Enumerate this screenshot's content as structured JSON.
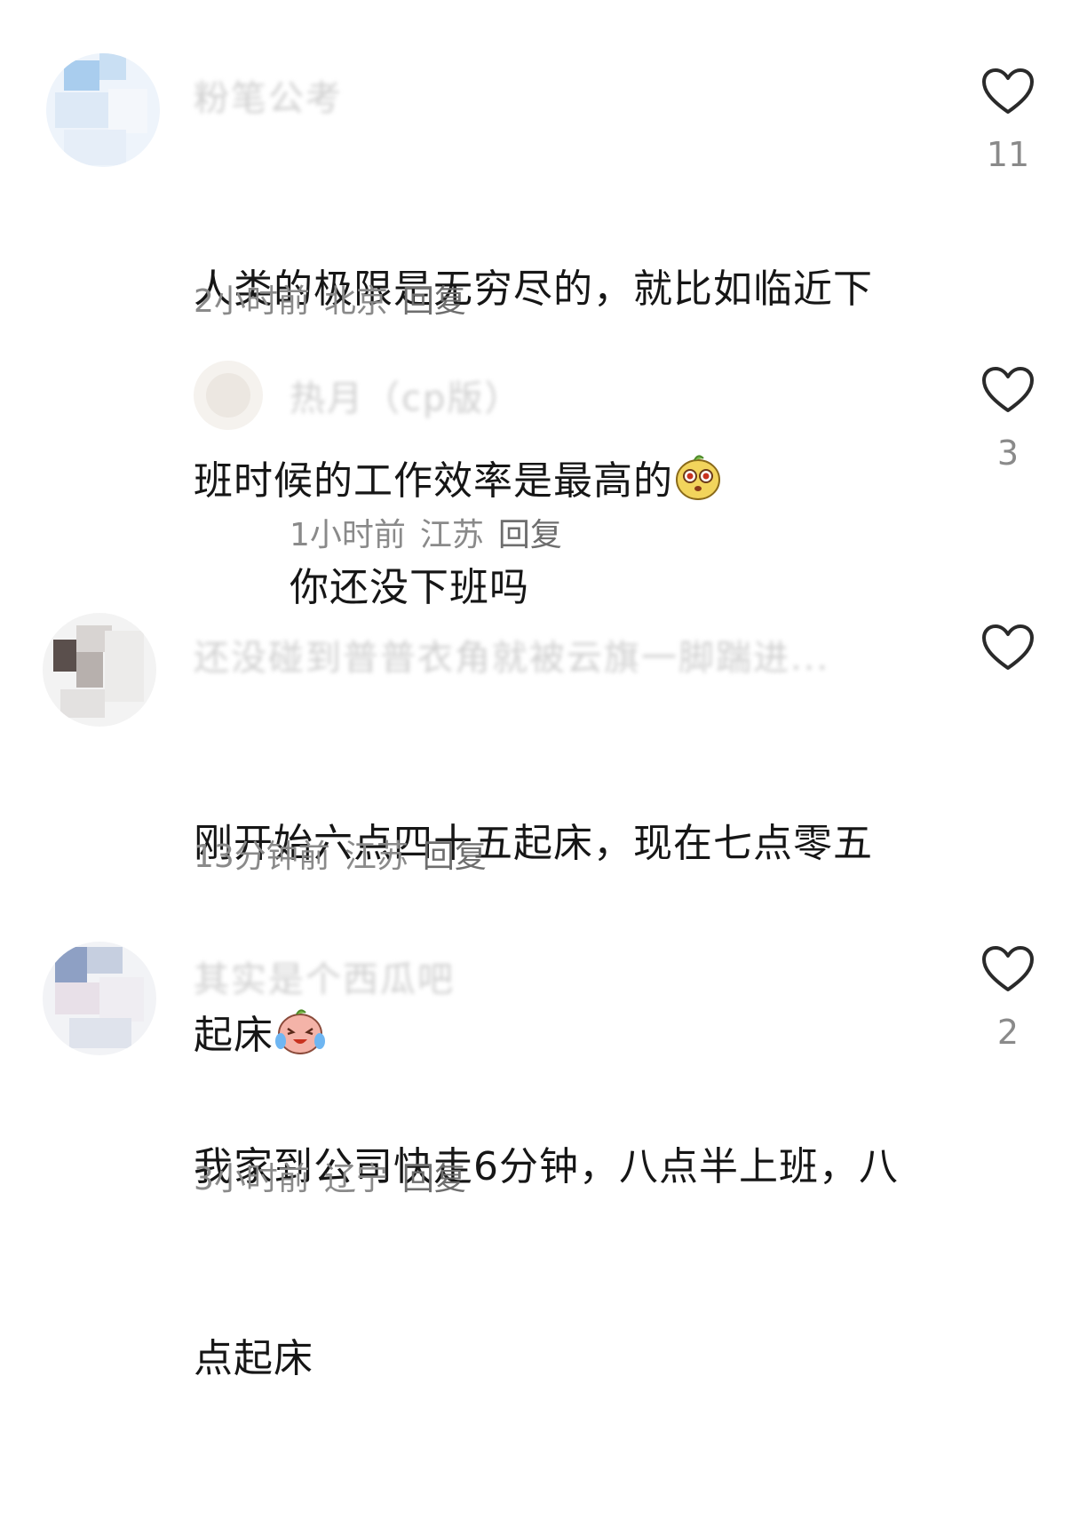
{
  "comments": [
    {
      "username": "粉笔公考",
      "text_line1": "人类的极限是无穷尽的，就比如临近下",
      "text_line2": "班时候的工作效率是最高的",
      "emoji": "mushroom-surprised-emoji",
      "time": "2小时前",
      "location": "北京",
      "reply_label": "回复",
      "likes": "11"
    },
    {
      "username": "热月（cp版）",
      "text_line1": "你还没下班吗",
      "time": "1小时前",
      "location": "江苏",
      "reply_label": "回复",
      "likes": "3"
    },
    {
      "username": "还没碰到普普衣角就被云旗一脚踹进...",
      "text_line1": "刚开始六点四十五起床，现在七点零五",
      "text_line2": "起床",
      "emoji": "crying-laughing-emoji",
      "time": "13分钟前",
      "location": "江苏",
      "reply_label": "回复",
      "likes": ""
    },
    {
      "username": "其实是个西瓜吧",
      "text_line1": "我家到公司快走6分钟，八点半上班，八",
      "text_line2": "点起床",
      "time": "3小时前",
      "location": "辽宁",
      "reply_label": "回复",
      "likes": "2"
    }
  ],
  "icons": {
    "like": "heart-outline-icon"
  },
  "colors": {
    "text": "#161616",
    "meta": "#8a8a8a",
    "icon": "#2a2a2a"
  }
}
